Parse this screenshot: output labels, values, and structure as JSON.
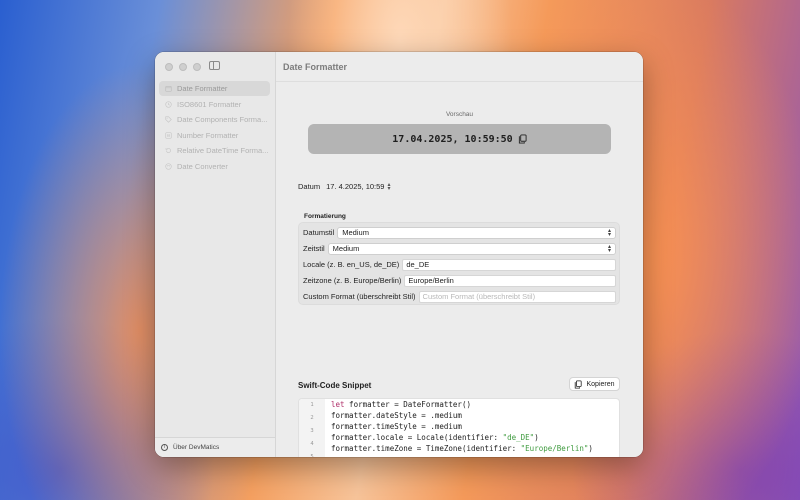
{
  "window": {
    "title": "Date Formatter"
  },
  "sidebar": {
    "items": [
      {
        "label": "Date Formatter",
        "icon": "calendar-icon",
        "active": true
      },
      {
        "label": "ISO8601 Formatter",
        "icon": "clock-icon",
        "active": false
      },
      {
        "label": "Date Components Forma...",
        "icon": "tag-icon",
        "active": false
      },
      {
        "label": "Number Formatter",
        "icon": "number-icon",
        "active": false
      },
      {
        "label": "Relative DateTime Forma...",
        "icon": "history-icon",
        "active": false
      },
      {
        "label": "Date Converter",
        "icon": "refresh-icon",
        "active": false
      }
    ],
    "footer_label": "Über DevMatics"
  },
  "preview": {
    "label": "Vorschau",
    "value": "17.04.2025, 10:59:50"
  },
  "datum": {
    "label": "Datum",
    "value": "17.  4.2025, 10:59"
  },
  "formatting": {
    "title": "Formatierung",
    "date_style_label": "Datumstil",
    "date_style_value": "Medium",
    "time_style_label": "Zeitstil",
    "time_style_value": "Medium",
    "locale_label": "Locale (z. B. en_US, de_DE)",
    "locale_value": "de_DE",
    "timezone_label": "Zeitzone (z. B. Europe/Berlin)",
    "timezone_value": "Europe/Berlin",
    "custom_label": "Custom Format (überschreibt Stil)",
    "custom_placeholder": "Custom Format (überschreibt Stil)"
  },
  "snippet": {
    "title": "Swift-Code Snippet",
    "copy_label": "Kopieren",
    "line_numbers": [
      "1",
      "2",
      "3",
      "4",
      "5"
    ],
    "lines": [
      {
        "keyword": "let",
        "rest": " formatter = DateFormatter()"
      },
      {
        "code": "formatter.dateStyle = .medium"
      },
      {
        "code": "formatter.timeStyle = .medium"
      },
      {
        "before": "formatter.locale = Locale(identifier: ",
        "string": "\"de_DE\"",
        "after": ")"
      },
      {
        "before": "formatter.timeZone = TimeZone(identifier: ",
        "string": "\"Europe/Berlin\"",
        "after": ")"
      }
    ]
  }
}
